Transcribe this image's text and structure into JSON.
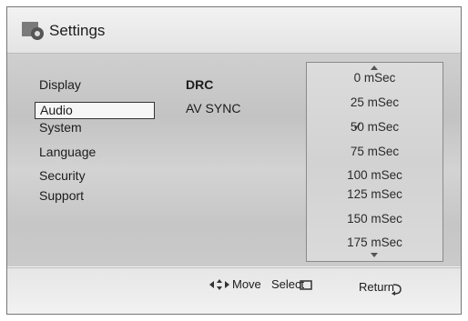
{
  "window": {
    "title": "Settings"
  },
  "sidebar": {
    "items": [
      {
        "label": "Display"
      },
      {
        "label": "Audio"
      },
      {
        "label": "System"
      },
      {
        "label": "Language"
      },
      {
        "label": "Security"
      },
      {
        "label": "Support"
      }
    ],
    "selected": "Audio"
  },
  "options": [
    {
      "label": "DRC"
    },
    {
      "label": "AV SYNC"
    }
  ],
  "av_sync_list": {
    "items": [
      "0 mSec",
      "25 mSec",
      "50 mSec",
      "75 mSec",
      "100 mSec",
      "125 mSec",
      "150 mSec",
      "175 mSec"
    ],
    "checked": "50 mSec"
  },
  "footer": {
    "move_label": "Move",
    "select_label": "Select",
    "return_label": "Return"
  },
  "icons": {
    "title": "settings-gear-icon",
    "move": "arrow-pad-icon",
    "select": "enter-button-icon",
    "return": "return-arrow-icon"
  }
}
